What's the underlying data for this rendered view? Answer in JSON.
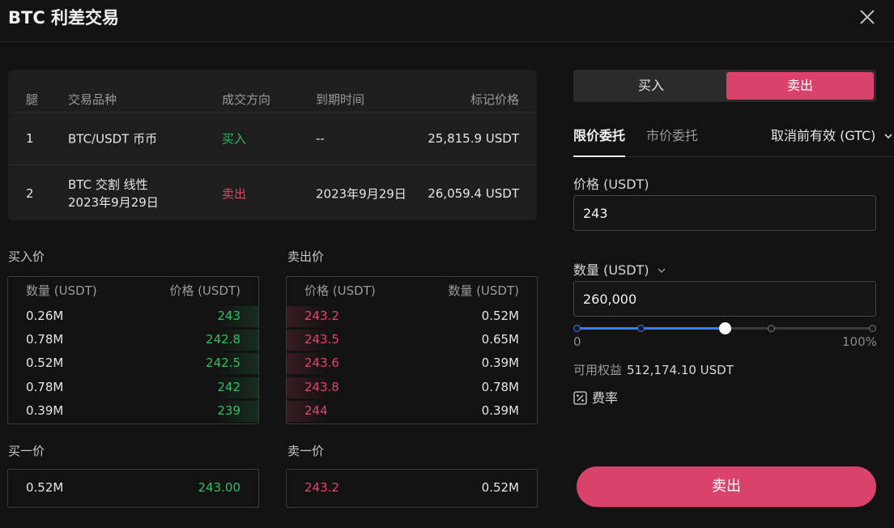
{
  "header": {
    "title": "BTC 利差交易"
  },
  "legs": {
    "columns": {
      "leg": "腿",
      "instrument": "交易品种",
      "direction": "成交方向",
      "expiry": "到期时间",
      "mark": "标记价格"
    },
    "rows": [
      {
        "leg": "1",
        "instrument_line1": "BTC/USDT 币币",
        "instrument_line2": "",
        "direction": "买入",
        "expiry": "--",
        "mark": "25,815.9 USDT"
      },
      {
        "leg": "2",
        "instrument_line1": "BTC 交割 线性",
        "instrument_line2": "2023年9月29日",
        "direction": "卖出",
        "expiry": "2023年9月29日",
        "mark": "26,059.4 USDT"
      }
    ]
  },
  "bids": {
    "label": "买入价",
    "col_qty": "数量 (USDT)",
    "col_price": "价格 (USDT)",
    "rows": [
      {
        "qty": "0.26M",
        "price": "243"
      },
      {
        "qty": "0.78M",
        "price": "242.8"
      },
      {
        "qty": "0.52M",
        "price": "242.5"
      },
      {
        "qty": "0.78M",
        "price": "242"
      },
      {
        "qty": "0.39M",
        "price": "239"
      }
    ]
  },
  "asks": {
    "label": "卖出价",
    "col_price": "价格 (USDT)",
    "col_qty": "数量 (USDT)",
    "rows": [
      {
        "price": "243.2",
        "qty": "0.52M"
      },
      {
        "price": "243.5",
        "qty": "0.65M"
      },
      {
        "price": "243.6",
        "qty": "0.39M"
      },
      {
        "price": "243.8",
        "qty": "0.78M"
      },
      {
        "price": "244",
        "qty": "0.39M"
      }
    ]
  },
  "best_bid": {
    "label": "买一价",
    "qty": "0.52M",
    "price": "243.00"
  },
  "best_ask": {
    "label": "卖一价",
    "price": "243.2",
    "qty": "0.52M"
  },
  "order": {
    "side_buy": "买入",
    "side_sell": "卖出",
    "tab_limit": "限价委托",
    "tab_market": "市价委托",
    "time_in_force": "取消前有效 (GTC)",
    "price_label": "价格 (USDT)",
    "price_value": "243",
    "qty_label": "数量 (USDT)",
    "qty_value": "260,000",
    "slider_min": "0",
    "slider_max": "100%",
    "slider_percent": 50,
    "available_label": "可用权益",
    "available_value": "512,174.10 USDT",
    "fee_label": "费率",
    "submit_label": "卖出"
  },
  "colors": {
    "buy": "#2fbf5f",
    "sell": "#e0456c",
    "accent": "#d9426a",
    "slider": "#3b7cff"
  }
}
